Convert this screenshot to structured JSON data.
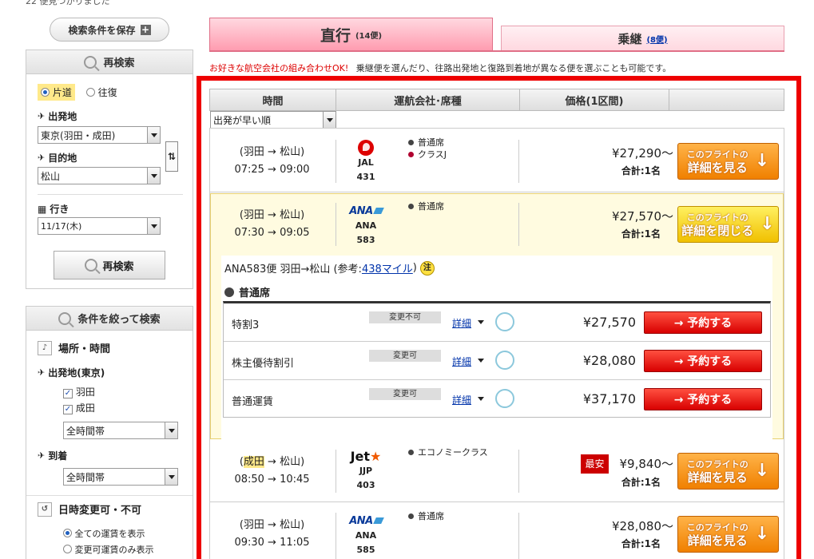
{
  "top_count_text": "22 便見つかりました",
  "sidebar": {
    "save_label": "検索条件を保存",
    "research": {
      "title": "再検索",
      "trip_oneway": "片道",
      "trip_round": "往復",
      "origin_label": "出発地",
      "origin_value": "東京(羽田・成田)",
      "dest_label": "目的地",
      "dest_value": "松山",
      "date_label": "行き",
      "date_value": "11/17(木)",
      "button": "再検索"
    },
    "narrow": {
      "title": "条件を絞って検索",
      "place_time": "場所・時間",
      "dep_label": "出発地(東京)",
      "haneda": "羽田",
      "narita": "成田",
      "dep_time": "全時間帯",
      "arr_label": "到着",
      "arr_time": "全時間帯",
      "change_label": "日時変更可・不可",
      "show_all": "全ての運賃を表示",
      "show_changeable": "変更可運賃のみ表示"
    }
  },
  "tabs": {
    "direct_label": "直行",
    "direct_count": "(14便)",
    "transit_label": "乗継",
    "transit_count": "(8便)"
  },
  "notice": {
    "red": "お好きな航空会社の組み合わせOK!",
    "text": "乗継便を選んだり、往路出発地と復路到着地が異なる便を選ぶことも可能です。"
  },
  "table_header": {
    "time": "時間",
    "airline": "運航会社･席種",
    "price": "価格(1区間)"
  },
  "sort_value": "出発が早い順",
  "flights": [
    {
      "route": "(羽田 → 松山)",
      "time": "07:25 → 09:00",
      "airline": "JAL",
      "number": "431",
      "seats": [
        "普通席",
        "クラスJ"
      ],
      "price": "¥27,290〜",
      "sub": "合計:1名",
      "btn1": "このフライトの",
      "btn2": "詳細を見る"
    },
    {
      "route": "(羽田 → 松山)",
      "time": "07:30 → 09:05",
      "airline": "ANA",
      "number": "583",
      "seats": [
        "普通席"
      ],
      "price": "¥27,570〜",
      "sub": "合計:1名",
      "btn1": "このフライトの",
      "btn2": "詳細を閉じる"
    },
    {
      "route_pre": "(",
      "route_hl": "成田",
      "route_post": " → 松山)",
      "time": "08:50 → 10:45",
      "airline": "JJP",
      "number": "403",
      "seats": [
        "エコノミークラス"
      ],
      "cheapest": "最安",
      "price": "¥9,840〜",
      "sub": "合計:1名",
      "btn1": "このフライトの",
      "btn2": "詳細を見る"
    },
    {
      "route": "(羽田 → 松山)",
      "time": "09:30 → 11:05",
      "airline": "ANA",
      "number": "585",
      "seats": [
        "普通席"
      ],
      "price": "¥28,080〜",
      "sub": "合計:1名",
      "btn1": "このフライトの",
      "btn2": "詳細を見る"
    }
  ],
  "detail": {
    "title_pre": "ANA583便 羽田→松山 (参考:",
    "miles": "438マイル",
    "title_post": ")",
    "note_icon": "注",
    "seat_class": "普通席",
    "fares": [
      {
        "name": "特割3",
        "tag": "変更不可",
        "link": "詳細",
        "price": "¥27,570",
        "btn": "→ 予約する"
      },
      {
        "name": "株主優待割引",
        "tag": "変更可",
        "link": "詳細",
        "price": "¥28,080",
        "btn": "→ 予約する"
      },
      {
        "name": "普通運賃",
        "tag": "変更可",
        "link": "詳細",
        "price": "¥37,170",
        "btn": "→ 予約する"
      }
    ]
  }
}
